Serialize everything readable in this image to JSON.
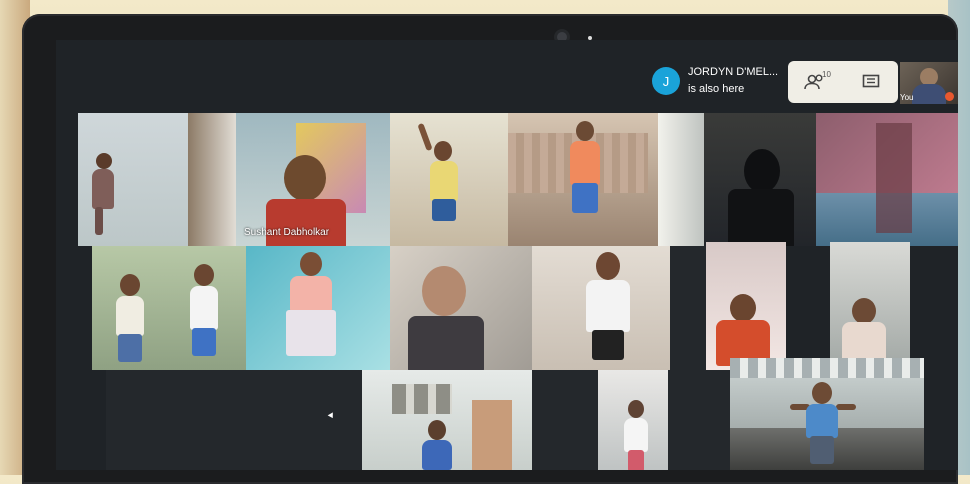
{
  "meet": {
    "notification": {
      "avatar_letter": "J",
      "name": "JORDYN D'MEL...",
      "message": "is also here"
    },
    "participants_count": "10",
    "self_label": "You",
    "tiles": [
      {
        "id": "t1",
        "name_label": ""
      },
      {
        "id": "t2",
        "name_label": "Sushant Dabholkar"
      },
      {
        "id": "t3",
        "name_label": ""
      },
      {
        "id": "t4",
        "name_label": ""
      },
      {
        "id": "t5",
        "name_label": ""
      },
      {
        "id": "t6",
        "name_label": ""
      },
      {
        "id": "t7",
        "name_label": ""
      },
      {
        "id": "t8",
        "name_label": ""
      },
      {
        "id": "t9",
        "name_label": ""
      },
      {
        "id": "t10",
        "name_label": ""
      },
      {
        "id": "t11",
        "name_label": ""
      },
      {
        "id": "t12",
        "name_label": ""
      },
      {
        "id": "t13",
        "name_label": ""
      },
      {
        "id": "t14",
        "name_label": ""
      },
      {
        "id": "t15",
        "name_label": ""
      }
    ]
  },
  "colors": {
    "accent_avatar": "#1aa3d9",
    "controls_bg": "#f0eee6",
    "screen_bg": "#1f2327",
    "self_badge": "#e8582f"
  },
  "icons": [
    "people-icon",
    "chat-icon"
  ]
}
